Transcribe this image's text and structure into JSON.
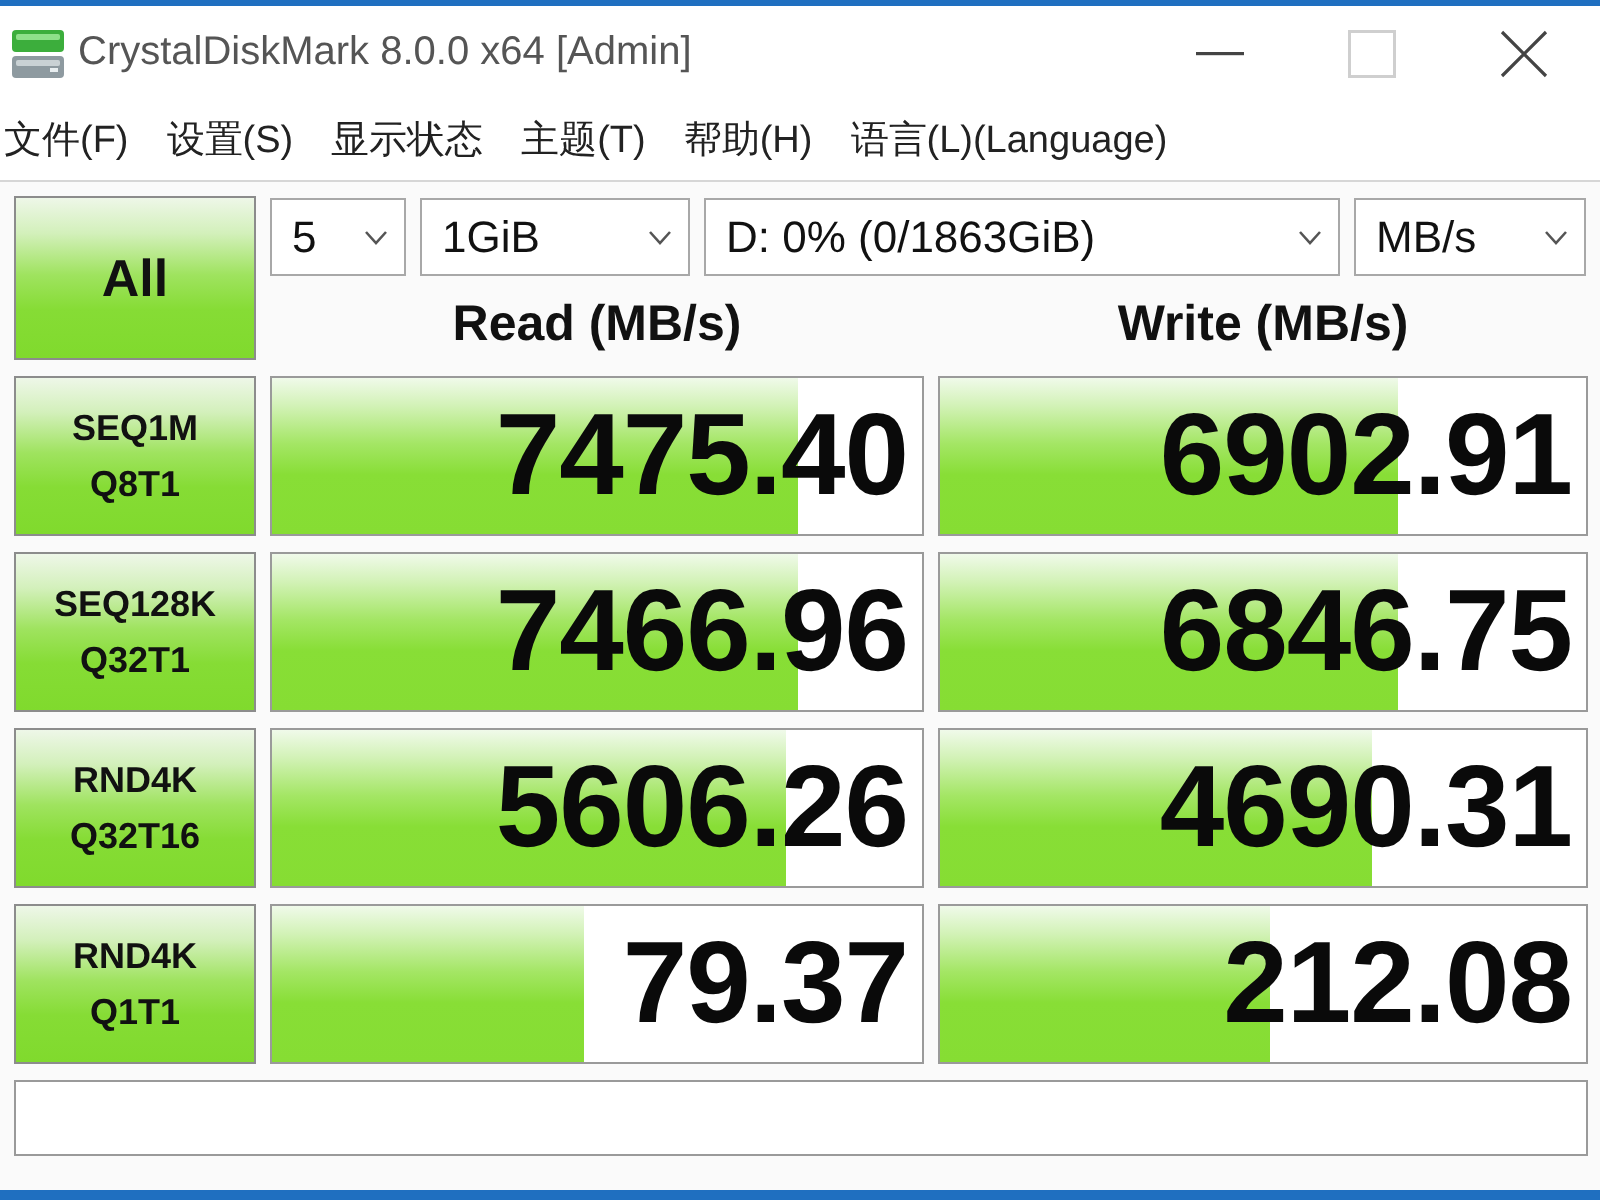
{
  "window": {
    "title": "CrystalDiskMark 8.0.0 x64 [Admin]",
    "buttons": [
      {
        "kind": "minimize",
        "disabled": false
      },
      {
        "kind": "maximize",
        "disabled": true
      },
      {
        "kind": "close",
        "disabled": false
      }
    ]
  },
  "menu": [
    "文件(F)",
    "设置(S)",
    "显示状态",
    "主题(T)",
    "帮助(H)",
    "语言(L)(Language)"
  ],
  "all_button": "All",
  "selectors": [
    {
      "value": "5"
    },
    {
      "value": "1GiB"
    },
    {
      "value": "D: 0% (0/1863GiB)"
    },
    {
      "value": "MB/s"
    }
  ],
  "columns": [
    "Read (MB/s)",
    "Write (MB/s)"
  ],
  "tests": [
    {
      "name": "SEQ1M",
      "params": "Q8T1",
      "read": {
        "value": "7475.40",
        "level": 0.81
      },
      "write": {
        "value": "6902.91",
        "level": 0.71
      }
    },
    {
      "name": "SEQ128K",
      "params": "Q32T1",
      "read": {
        "value": "7466.96",
        "level": 0.81
      },
      "write": {
        "value": "6846.75",
        "level": 0.71
      }
    },
    {
      "name": "RND4K",
      "params": "Q32T16",
      "read": {
        "value": "5606.26",
        "level": 0.79
      },
      "write": {
        "value": "4690.31",
        "level": 0.67
      }
    },
    {
      "name": "RND4K",
      "params": "Q1T1",
      "read": {
        "value": "79.37",
        "level": 0.48
      },
      "write": {
        "value": "212.08",
        "level": 0.51
      }
    }
  ]
}
